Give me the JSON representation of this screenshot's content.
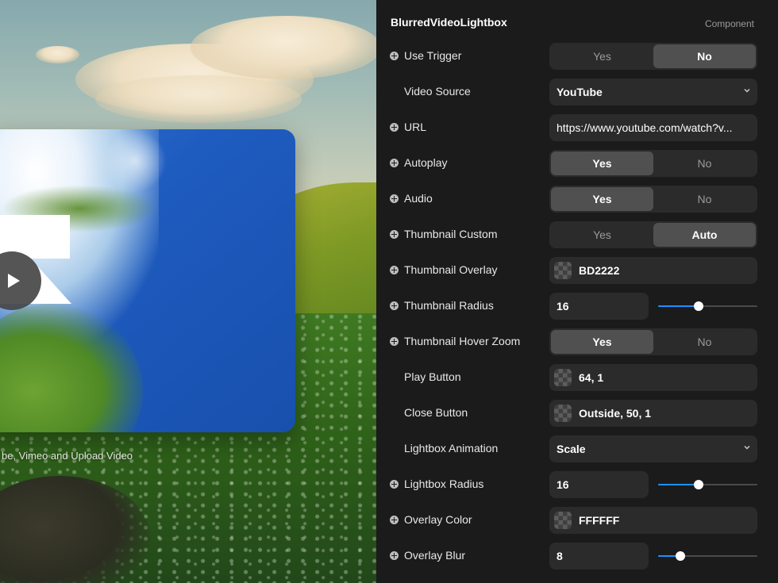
{
  "canvas": {
    "caption": "be, Vimeo and Upload Video"
  },
  "panel": {
    "title": "BlurredVideoLightbox",
    "badge": "Component"
  },
  "rows": {
    "use_trigger": {
      "label": "Use Trigger",
      "options": [
        "Yes",
        "No"
      ],
      "selected": "No"
    },
    "video_source": {
      "label": "Video Source",
      "value": "YouTube"
    },
    "url": {
      "label": "URL",
      "value": "https://www.youtube.com/watch?v..."
    },
    "autoplay": {
      "label": "Autoplay",
      "options": [
        "Yes",
        "No"
      ],
      "selected": "Yes"
    },
    "audio": {
      "label": "Audio",
      "options": [
        "Yes",
        "No"
      ],
      "selected": "Yes"
    },
    "thumbnail_custom": {
      "label": "Thumbnail Custom",
      "options": [
        "Yes",
        "Auto"
      ],
      "selected": "Auto"
    },
    "thumbnail_overlay": {
      "label": "Thumbnail Overlay",
      "value": "BD2222"
    },
    "thumbnail_radius": {
      "label": "Thumbnail Radius",
      "value": "16",
      "slider_fraction": 0.41
    },
    "thumbnail_hover_zoom": {
      "label": "Thumbnail Hover Zoom",
      "options": [
        "Yes",
        "No"
      ],
      "selected": "Yes"
    },
    "play_button": {
      "label": "Play Button",
      "value": "64, 1"
    },
    "close_button": {
      "label": "Close Button",
      "value": "Outside, 50, 1"
    },
    "lightbox_animation": {
      "label": "Lightbox Animation",
      "value": "Scale"
    },
    "lightbox_radius": {
      "label": "Lightbox Radius",
      "value": "16",
      "slider_fraction": 0.41
    },
    "overlay_color": {
      "label": "Overlay Color",
      "value": "FFFFFF"
    },
    "overlay_blur": {
      "label": "Overlay Blur",
      "value": "8",
      "slider_fraction": 0.22
    }
  },
  "colors": {
    "accent": "#1f8fff",
    "panel_bg": "#1b1b1b",
    "control_bg": "#2b2b2b",
    "segment_active": "#505050"
  },
  "icons": {
    "expand": "plus-circle-icon",
    "dropdown": "chevron-down-icon",
    "swatch": "color-swatch-icon",
    "play": "play-icon"
  }
}
